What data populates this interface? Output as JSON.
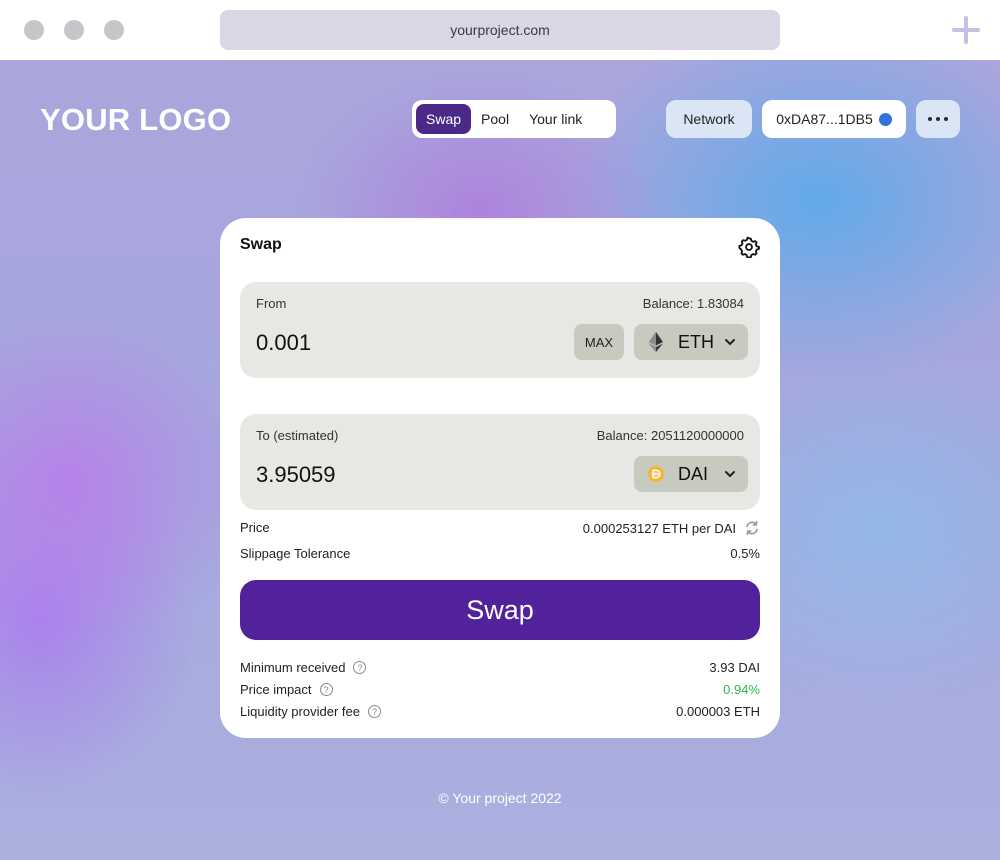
{
  "browser": {
    "url": "yourproject.com"
  },
  "header": {
    "logo": "YOUR LOGO",
    "nav": [
      {
        "label": "Swap",
        "active": true
      },
      {
        "label": "Pool",
        "active": false
      },
      {
        "label": "Your link",
        "active": false
      }
    ],
    "network_label": "Network",
    "account_address": "0xDA87...1DB5"
  },
  "swap": {
    "title": "Swap",
    "from": {
      "label": "From",
      "balance": "Balance: 1.83084",
      "amount": "0.001",
      "max_label": "MAX",
      "token": "ETH"
    },
    "to": {
      "label": "To (estimated)",
      "balance": "Balance: 2051120000000",
      "amount": "3.95059",
      "token": "DAI"
    },
    "price_label": "Price",
    "price_value": "0.000253127 ETH per DAI",
    "slippage_label": "Slippage Tolerance",
    "slippage_value": "0.5%",
    "swap_button": "Swap",
    "min_received_label": "Minimum received",
    "min_received_value": "3.93 DAI",
    "price_impact_label": "Price impact",
    "price_impact_value": "0.94%",
    "lp_fee_label": "Liquidity provider fee",
    "lp_fee_value": "0.000003 ETH",
    "help_glyph": "?"
  },
  "footer": {
    "text": "© Your project 2022"
  },
  "colors": {
    "accent": "#51229c",
    "nav_active": "#4a2a86",
    "positive": "#2fb84a",
    "account_dot": "#2f73d8",
    "dai_token": "#f4b731"
  }
}
